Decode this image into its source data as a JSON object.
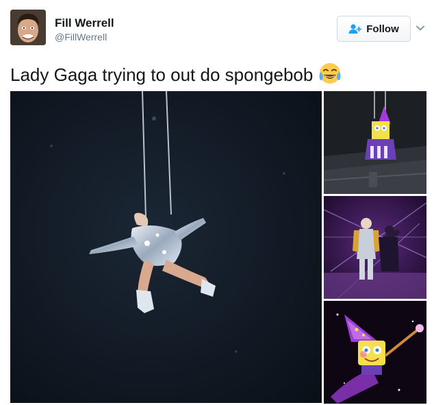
{
  "author": {
    "display_name": "Fill Werrell",
    "handle": "@FillWerrell",
    "avatar_icon": "avatar-photo"
  },
  "follow_button": {
    "label": "Follow",
    "icon": "add-user-icon",
    "accent": "#1da1f2"
  },
  "more_menu": {
    "icon": "chevron-down-icon"
  },
  "tweet": {
    "text": "Lady Gaga trying to out do spongebob",
    "emoji": "face-with-tears-of-joy"
  },
  "media": {
    "photos": [
      {
        "subject": "performer-suspended-on-wires"
      },
      {
        "subject": "cartoon-wizard-on-wires"
      },
      {
        "subject": "stage-performance"
      },
      {
        "subject": "cartoon-wizard-flying"
      }
    ]
  }
}
